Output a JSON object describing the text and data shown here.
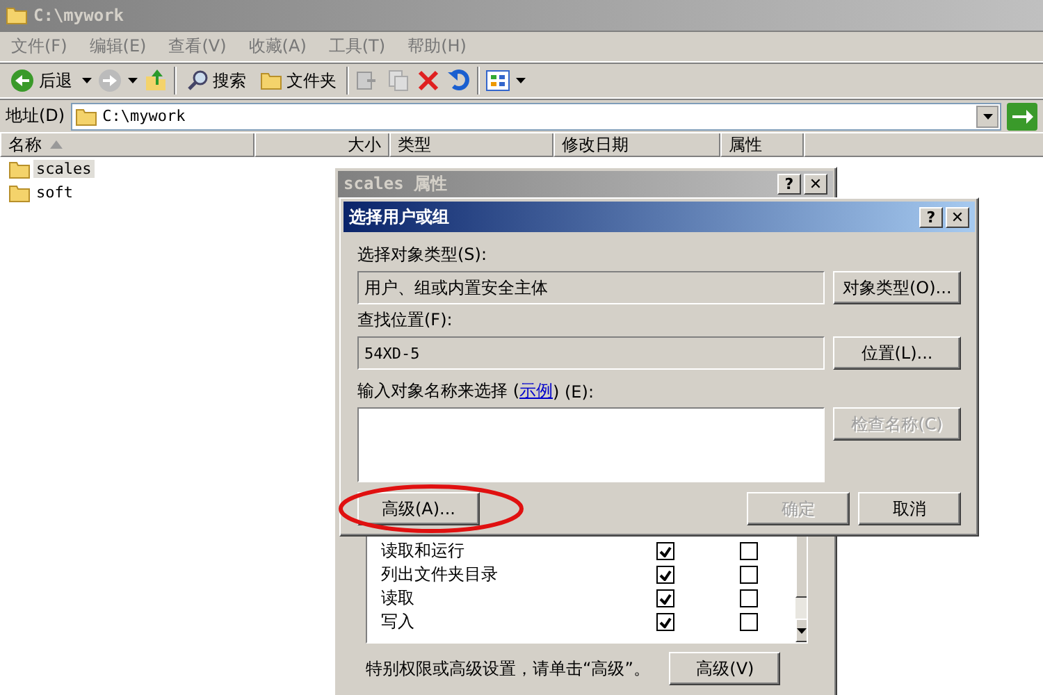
{
  "window": {
    "title": "C:\\mywork"
  },
  "menu": [
    {
      "label": "文件(F)"
    },
    {
      "label": "编辑(E)"
    },
    {
      "label": "查看(V)"
    },
    {
      "label": "收藏(A)"
    },
    {
      "label": "工具(T)"
    },
    {
      "label": "帮助(H)"
    }
  ],
  "toolbar": {
    "back": "后退",
    "search": "搜索",
    "folders": "文件夹"
  },
  "address": {
    "label": "地址(D)",
    "value": "C:\\mywork"
  },
  "columns": [
    {
      "label": "名称",
      "sorted": true
    },
    {
      "label": "大小",
      "sorted": false
    },
    {
      "label": "类型",
      "sorted": false
    },
    {
      "label": "修改日期",
      "sorted": false
    },
    {
      "label": "属性",
      "sorted": false
    }
  ],
  "files": [
    {
      "name": "scales",
      "selected": true
    },
    {
      "name": "soft",
      "selected": false
    }
  ],
  "properties_dialog": {
    "title": "scales 属性",
    "help_glyph": "?",
    "close_glyph": "✕",
    "permissions": [
      {
        "name": "读取和运行",
        "allow": true,
        "deny": false
      },
      {
        "name": "列出文件夹目录",
        "allow": true,
        "deny": false
      },
      {
        "name": "读取",
        "allow": true,
        "deny": false
      },
      {
        "name": "写入",
        "allow": true,
        "deny": false
      }
    ],
    "hint": "特别权限或高级设置，请单击“高级”。",
    "advanced_button": "高级(V)"
  },
  "select_dialog": {
    "title": "选择用户或组",
    "help_glyph": "?",
    "close_glyph": "✕",
    "object_type_label": "选择对象类型(S):",
    "object_type_value": "用户、组或内置安全主体",
    "object_type_button": "对象类型(O)...",
    "location_label": "查找位置(F):",
    "location_value": "54XD-5",
    "location_button": "位置(L)...",
    "names_label_before": "输入对象名称来选择 (",
    "names_link": "示例",
    "names_label_after": ") (E):",
    "check_names_button": "检查名称(C)",
    "check_names_disabled": true,
    "advanced_button": "高级(A)...",
    "ok_button": "确定",
    "ok_disabled": true,
    "cancel_button": "取消",
    "advanced_highlighted": true
  }
}
